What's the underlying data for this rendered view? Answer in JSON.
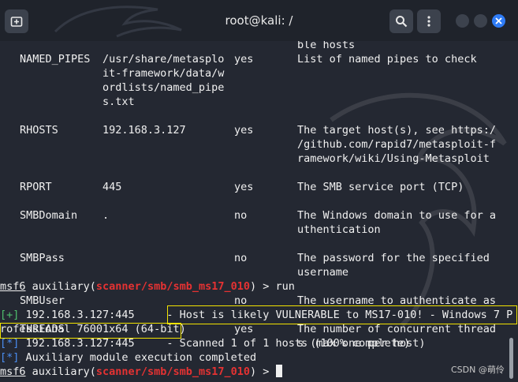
{
  "window": {
    "title": "root@kali: /"
  },
  "icons": {
    "new_tab": "new-tab-icon",
    "search": "search-icon",
    "menu": "kebab-menu-icon",
    "close": "close-icon"
  },
  "colors": {
    "module_red": "#e53232",
    "plus_green": "#4fbf6d",
    "star_blue": "#4a8df0",
    "highlight_yellow": "#f2e300"
  },
  "options": [
    {
      "lines": [
        [
          "",
          "",
          "",
          "ble hosts"
        ]
      ]
    },
    {
      "lines": [
        [
          "NAMED_PIPES",
          "/usr/share/metasplo",
          "yes",
          "List of named pipes to check"
        ],
        [
          "",
          "it-framework/data/w",
          "",
          ""
        ],
        [
          "",
          "ordlists/named_pipe",
          "",
          ""
        ],
        [
          "",
          "s.txt",
          "",
          ""
        ]
      ]
    },
    {
      "lines": [
        [
          "RHOSTS",
          "192.168.3.127",
          "yes",
          "The target host(s), see https:/"
        ],
        [
          "",
          "",
          "",
          "/github.com/rapid7/metasploit-f"
        ],
        [
          "",
          "",
          "",
          "ramework/wiki/Using-Metasploit"
        ]
      ]
    },
    {
      "lines": [
        [
          "RPORT",
          "445",
          "yes",
          "The SMB service port (TCP)"
        ]
      ]
    },
    {
      "lines": [
        [
          "SMBDomain",
          ".",
          "no",
          "The Windows domain to use for a"
        ],
        [
          "",
          "",
          "",
          "uthentication"
        ]
      ]
    },
    {
      "lines": [
        [
          "SMBPass",
          "",
          "no",
          "The password for the specified"
        ],
        [
          "",
          "",
          "",
          "username"
        ]
      ]
    },
    {
      "lines": [
        [
          "SMBUser",
          "",
          "no",
          "The username to authenticate as"
        ]
      ]
    },
    {
      "lines": [
        [
          "THREADS",
          "1",
          "yes",
          "The number of concurrent thread"
        ],
        [
          "",
          "",
          "",
          "s (max one per host)"
        ]
      ]
    }
  ],
  "prompt1": {
    "msf": "msf6",
    "pre": " auxiliary(",
    "module": "scanner/smb/smb_ms17_010",
    "post": ") > ",
    "command": "run"
  },
  "output": {
    "line1_tag": "[+]",
    "line1_host": " 192.168.3.127:445     - ",
    "line1_msg": "Host is likely VULNERABLE to MS17-010! - Windows 7 P",
    "line2": "rofessional 7600 x64 (64-bit)",
    "line3_tag": "[*]",
    "line3_text": " 192.168.3.127:445     - Scanned 1 of 1 hosts (100% complete)",
    "line4_tag": "[*]",
    "line4_text": " Auxiliary module execution completed"
  },
  "prompt2": {
    "msf": "msf6",
    "pre": " auxiliary(",
    "module": "scanner/smb/smb_ms17_010",
    "post": ") > "
  },
  "watermark": "CSDN @萌伶"
}
